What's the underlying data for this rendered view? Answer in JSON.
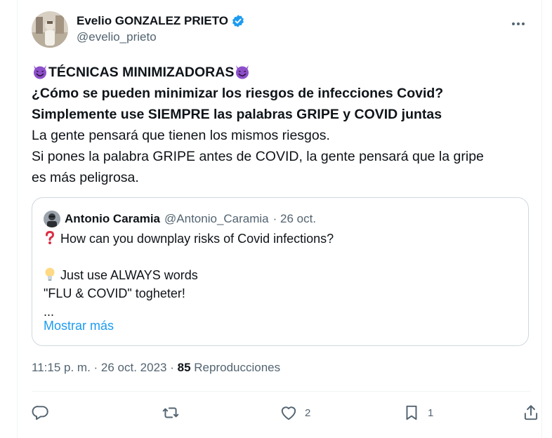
{
  "author": {
    "display_name": "Evelio GONZALEZ PRIETO",
    "handle": "@evelio_prieto",
    "verified": true
  },
  "icons": {
    "more": "more-horizontal-icon",
    "verified": "verified-badge-icon",
    "reply": "reply-icon",
    "retweet": "retweet-icon",
    "like": "heart-icon",
    "bookmark": "bookmark-icon",
    "share": "share-icon"
  },
  "tweet": {
    "title": "TÉCNICAS MINIMIZADORAS",
    "bold_line_1": "¿Cómo se pueden minimizar los riesgos de infecciones Covid?",
    "bold_line_2": "Simplemente use SIEMPRE las palabras GRIPE y COVID juntas",
    "line_3": "La gente pensará que tienen los mismos riesgos.",
    "line_4": "Si pones la palabra GRIPE antes de COVID, la gente pensará que la gripe",
    "line_5": "es más peligrosa."
  },
  "quoted": {
    "display_name": "Antonio Caramia",
    "handle": "@Antonio_Caramia",
    "date": "· 26 oct.",
    "line_1": "How can you downplay risks of Covid infections?",
    "line_2": "",
    "line_3": "Just use ALWAYS words",
    "line_4": "\"FLU & COVID\" togheter!",
    "line_5": "...",
    "show_more": "Mostrar más"
  },
  "meta": {
    "time": "11:15 p. m.",
    "date": "26 oct. 2023",
    "views_count": "85",
    "views_label": "Reproducciones"
  },
  "actions": {
    "replies": "",
    "retweets": "",
    "likes": "2",
    "bookmarks": "1"
  },
  "colors": {
    "text": "#0f1419",
    "secondary": "#536471",
    "link": "#1d9bf0",
    "border": "#cfd9de",
    "verified": "#1d9bf0",
    "devil_emoji": "#8c4fc9"
  }
}
